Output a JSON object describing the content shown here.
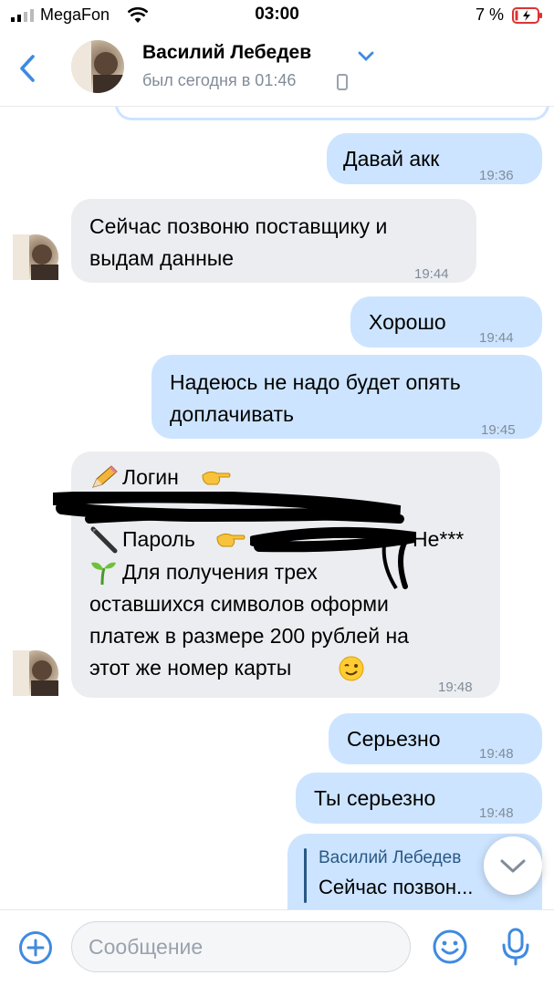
{
  "status_bar": {
    "carrier": "MegaFon",
    "time": "03:00",
    "battery": "7 %"
  },
  "header": {
    "name": "Василий Лебедев",
    "last_seen": "был сегодня в 01:46"
  },
  "messages": [
    {
      "dir": "out",
      "text": "Давай акк",
      "time": "19:36"
    },
    {
      "dir": "in",
      "lines": [
        "Сейчас позвоню поставщику и",
        "выдам данные"
      ],
      "time": "19:44"
    },
    {
      "dir": "out",
      "text": "Хорошо",
      "time": "19:44"
    },
    {
      "dir": "out",
      "lines": [
        "Надеюсь не надо будет опять",
        "доплачивать"
      ],
      "time": "19:45"
    },
    {
      "dir": "in",
      "login_label": "Логин",
      "password_label": "Пароль",
      "password_tail": "Не***",
      "lines": [
        "Для получения трех",
        "оставшихся символов оформи",
        "платеж в размере 200 рублей на",
        "этот же номер карты"
      ],
      "time": "19:48"
    },
    {
      "dir": "out",
      "text": "Серьезно",
      "time": "19:48"
    },
    {
      "dir": "out",
      "text": "Ты серьезно",
      "time": "19:48"
    },
    {
      "dir": "out",
      "reply_author": "Василий Лебедев",
      "reply_text": "Сейчас позвон..."
    }
  ],
  "input": {
    "placeholder": "Сообщение"
  },
  "colors": {
    "accent": "#2a5885",
    "incoming": "#ebedf0",
    "outgoing": "#cce4ff",
    "meta": "#818c99",
    "icon": "#3f8ae0"
  },
  "icons": [
    "back-icon",
    "chevron-down-icon",
    "phone-icon",
    "plus-icon",
    "smile-icon",
    "mic-icon",
    "scroll-down-icon"
  ]
}
